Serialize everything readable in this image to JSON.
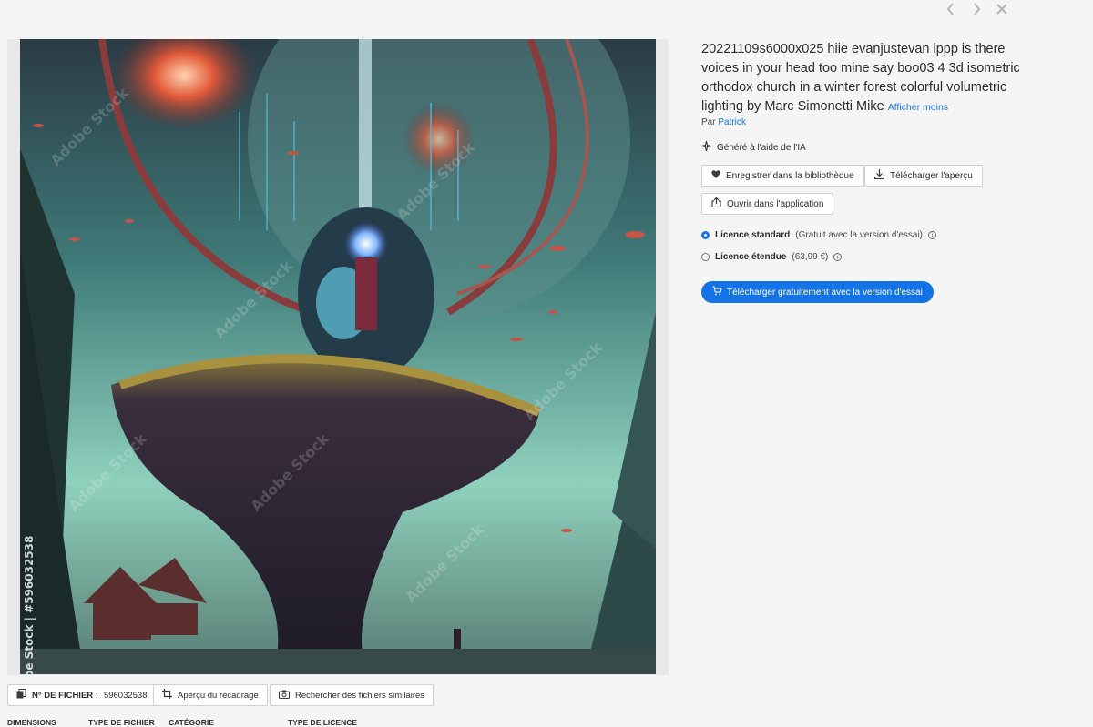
{
  "nav": {
    "prev_icon": "chevron-left-icon",
    "next_icon": "chevron-right-icon",
    "close_icon": "close-icon"
  },
  "image": {
    "watermark_id": "Adobe Stock | #596032538",
    "watermark_brand": "Adobe Stock"
  },
  "asset": {
    "title": "20221109s6000x025 hiie evanjustevan lppp is there voices in your head too mine say boo03 4 3d isometric orthodox church in a winter forest colorful volumetric lighting by Marc Simonetti Mike",
    "show_less": "Afficher moins",
    "by_label": "Par",
    "author": "Patrick",
    "ai_label": "Généré à l'aide de l'IA"
  },
  "actions": {
    "save_library": "Enregistrer dans la bibliothèque",
    "download_preview": "Télécharger l'aperçu",
    "open_in_app": "Ouvrir dans l'application"
  },
  "licenses": [
    {
      "name": "Licence standard",
      "note": "(Gratuit avec la version d'essai)",
      "selected": true
    },
    {
      "name": "Licence étendue",
      "note": "(63,99 €)",
      "selected": false
    }
  ],
  "cta": {
    "label": "Télécharger gratuitement avec la version d'essai"
  },
  "file": {
    "number_label": "N° DE FICHIER :",
    "number_value": "596032538",
    "crop_preview": "Aperçu du recadrage",
    "find_similar": "Rechercher des fichiers similaires"
  },
  "meta_headers": {
    "dimensions": "DIMENSIONS",
    "file_type": "TYPE DE FICHIER",
    "category": "CATÉGORIE",
    "license_type": "TYPE DE LICENCE"
  },
  "colors": {
    "accent": "#1473e6",
    "background": "#f5f5f5",
    "text": "#2c2c2c"
  }
}
